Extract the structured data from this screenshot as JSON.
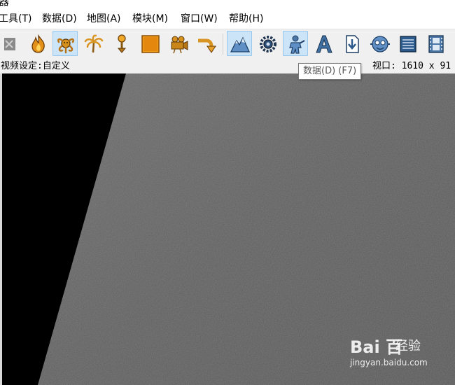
{
  "window": {
    "title_fragment": "器"
  },
  "menu": {
    "items": [
      {
        "label": "工具(T)"
      },
      {
        "label": "数据(D)"
      },
      {
        "label": "地图(A)"
      },
      {
        "label": "模块(M)"
      },
      {
        "label": "窗口(W)"
      },
      {
        "label": "帮助(H)"
      }
    ]
  },
  "toolbar": {
    "buttons": [
      {
        "icon": "terrain-brush-icon",
        "active": false
      },
      {
        "icon": "fire-doodad-icon",
        "active": false
      },
      {
        "icon": "unit-creature-icon",
        "active": true
      },
      {
        "icon": "palm-tree-icon",
        "active": false
      },
      {
        "icon": "torch-icon",
        "active": false
      },
      {
        "icon": "region-square-icon",
        "active": false
      },
      {
        "icon": "camera-icon",
        "active": false
      },
      {
        "icon": "path-arrow-icon",
        "active": false
      },
      {
        "icon": "terrain-editor-icon",
        "active": true
      },
      {
        "icon": "trigger-editor-icon",
        "active": false
      },
      {
        "icon": "data-object-editor-icon",
        "active": true
      },
      {
        "icon": "text-editor-icon",
        "active": false
      },
      {
        "icon": "import-manager-icon",
        "active": false
      },
      {
        "icon": "ai-editor-icon",
        "active": false
      },
      {
        "icon": "sound-editor-icon",
        "active": false
      },
      {
        "icon": "cinematic-film-icon",
        "active": false
      }
    ]
  },
  "status": {
    "video_setting": "视频设定:自定义",
    "viewport_size": "视口: 1610 x 91"
  },
  "tooltip": {
    "text": "数据(D) (F7)"
  },
  "watermark": {
    "brand": "Bai 百",
    "product": "经验",
    "url": "jingyan.baidu.com"
  },
  "colors": {
    "toolbar_bg": "#f0f0f0",
    "active_button_bg": "#cce4f7",
    "active_button_border": "#99c9ef",
    "viewport_void": "#000000",
    "ground": "#5a5a5a"
  }
}
